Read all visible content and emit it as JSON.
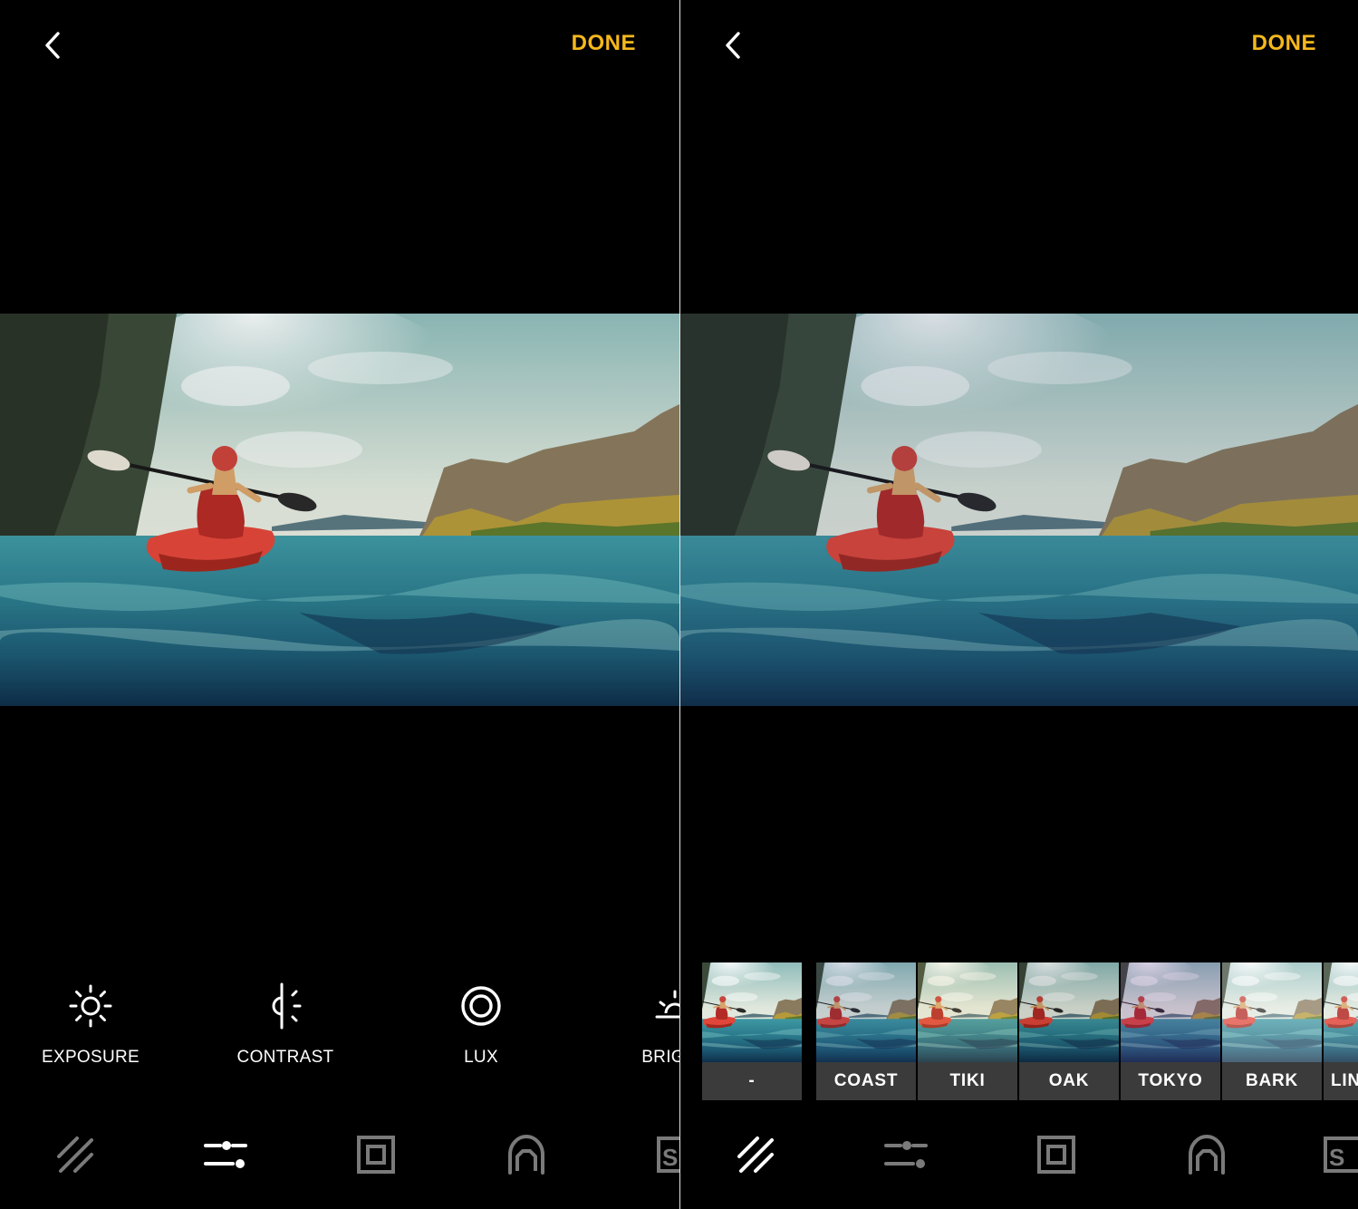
{
  "left": {
    "done_label": "DONE",
    "adjustments": [
      {
        "label": "EXPOSURE",
        "icon": "sun-icon"
      },
      {
        "label": "CONTRAST",
        "icon": "contrast-icon"
      },
      {
        "label": "LUX",
        "icon": "lux-icon"
      },
      {
        "label": "BRIGHT",
        "icon": "sunrise-icon"
      }
    ]
  },
  "right": {
    "done_label": "DONE",
    "filters": [
      {
        "label": "-"
      },
      {
        "label": "COAST"
      },
      {
        "label": "TIKI"
      },
      {
        "label": "OAK"
      },
      {
        "label": "TOKYO"
      },
      {
        "label": "BARK"
      },
      {
        "label": "LIN"
      }
    ]
  },
  "toolbar": {
    "icons": [
      "filters-icon",
      "adjust-sliders-icon",
      "frame-icon",
      "retouch-face-icon",
      "straighten-icon"
    ]
  },
  "colors": {
    "accent": "#f5b81c",
    "background": "#000000",
    "active_icon": "#ffffff",
    "inactive_icon": "#7a7a7a",
    "filter_label_bg": "#3b3b3b"
  }
}
